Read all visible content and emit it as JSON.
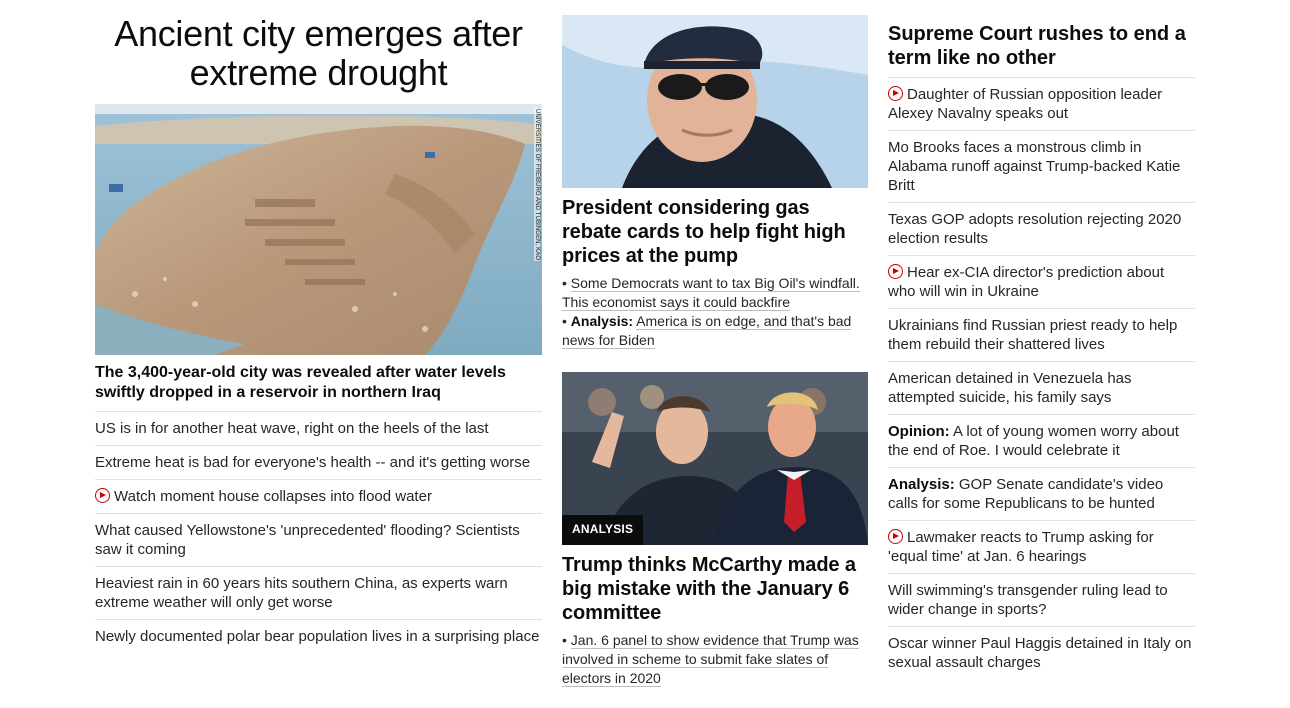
{
  "left": {
    "headline": "Ancient city emerges after extreme drought",
    "image_credit": "UNIVERSITIES OF FREIBURG AND TUBINGEN, KAO",
    "caption": "The 3,400-year-old city was revealed after water levels swiftly dropped in a reservoir in northern Iraq",
    "links": [
      {
        "text": "US is in for another heat wave, right on the heels of the last"
      },
      {
        "text": "Extreme heat is bad for everyone's health -- and it's getting worse"
      },
      {
        "text": "Watch moment house collapses into flood water",
        "icon": "play-icon"
      },
      {
        "text": "What caused Yellowstone's 'unprecedented' flooding? Scientists saw it coming"
      },
      {
        "text": "Heaviest rain in 60 years hits southern China, as experts warn extreme weather will only get worse"
      },
      {
        "text": "Newly documented polar bear population lives in a surprising place"
      }
    ]
  },
  "middle": {
    "story1": {
      "headline": "President considering gas rebate cards to help fight high prices at the pump",
      "sub1": "Some Democrats want to tax Big Oil's windfall. This economist says it could backfire",
      "sub2_label": "Analysis:",
      "sub2": "America is on edge, and that's bad news for Biden"
    },
    "story2": {
      "badge": "ANALYSIS",
      "headline": "Trump thinks McCarthy made a big mistake with the January 6 committee",
      "sub1": "Jan. 6 panel to show evidence that Trump was involved in scheme to submit fake slates of electors in 2020"
    }
  },
  "right": {
    "headline": "Supreme Court rushes to end a term like no other",
    "links": [
      {
        "text": "Daughter of Russian opposition leader Alexey Navalny speaks out",
        "icon": "play-icon"
      },
      {
        "text": "Mo Brooks faces a monstrous climb in Alabama runoff against Trump-backed Katie Britt"
      },
      {
        "text": "Texas GOP adopts resolution rejecting 2020 election results"
      },
      {
        "text": "Hear ex-CIA director's prediction about who will win in Ukraine",
        "icon": "play-icon"
      },
      {
        "text": "Ukrainians find Russian priest ready to help them rebuild their shattered lives"
      },
      {
        "text": "American detained in Venezuela has attempted suicide, his family says"
      },
      {
        "label": "Opinion:",
        "text": "A lot of young women worry about the end of Roe. I would celebrate it"
      },
      {
        "label": "Analysis:",
        "text": "GOP Senate candidate's video calls for some Republicans to be hunted"
      },
      {
        "text": "Lawmaker reacts to Trump asking for 'equal time' at Jan. 6 hearings",
        "icon": "play-icon"
      },
      {
        "text": "Will swimming's transgender ruling lead to wider change in sports?"
      },
      {
        "text": "Oscar winner Paul Haggis detained in Italy on sexual assault charges"
      }
    ]
  },
  "colors": {
    "text": "#0c0c0c",
    "secondary_text": "#262626",
    "play_red": "#cc0000",
    "divider": "#e1e1e1",
    "badge_bg": "#0c0c0c"
  }
}
